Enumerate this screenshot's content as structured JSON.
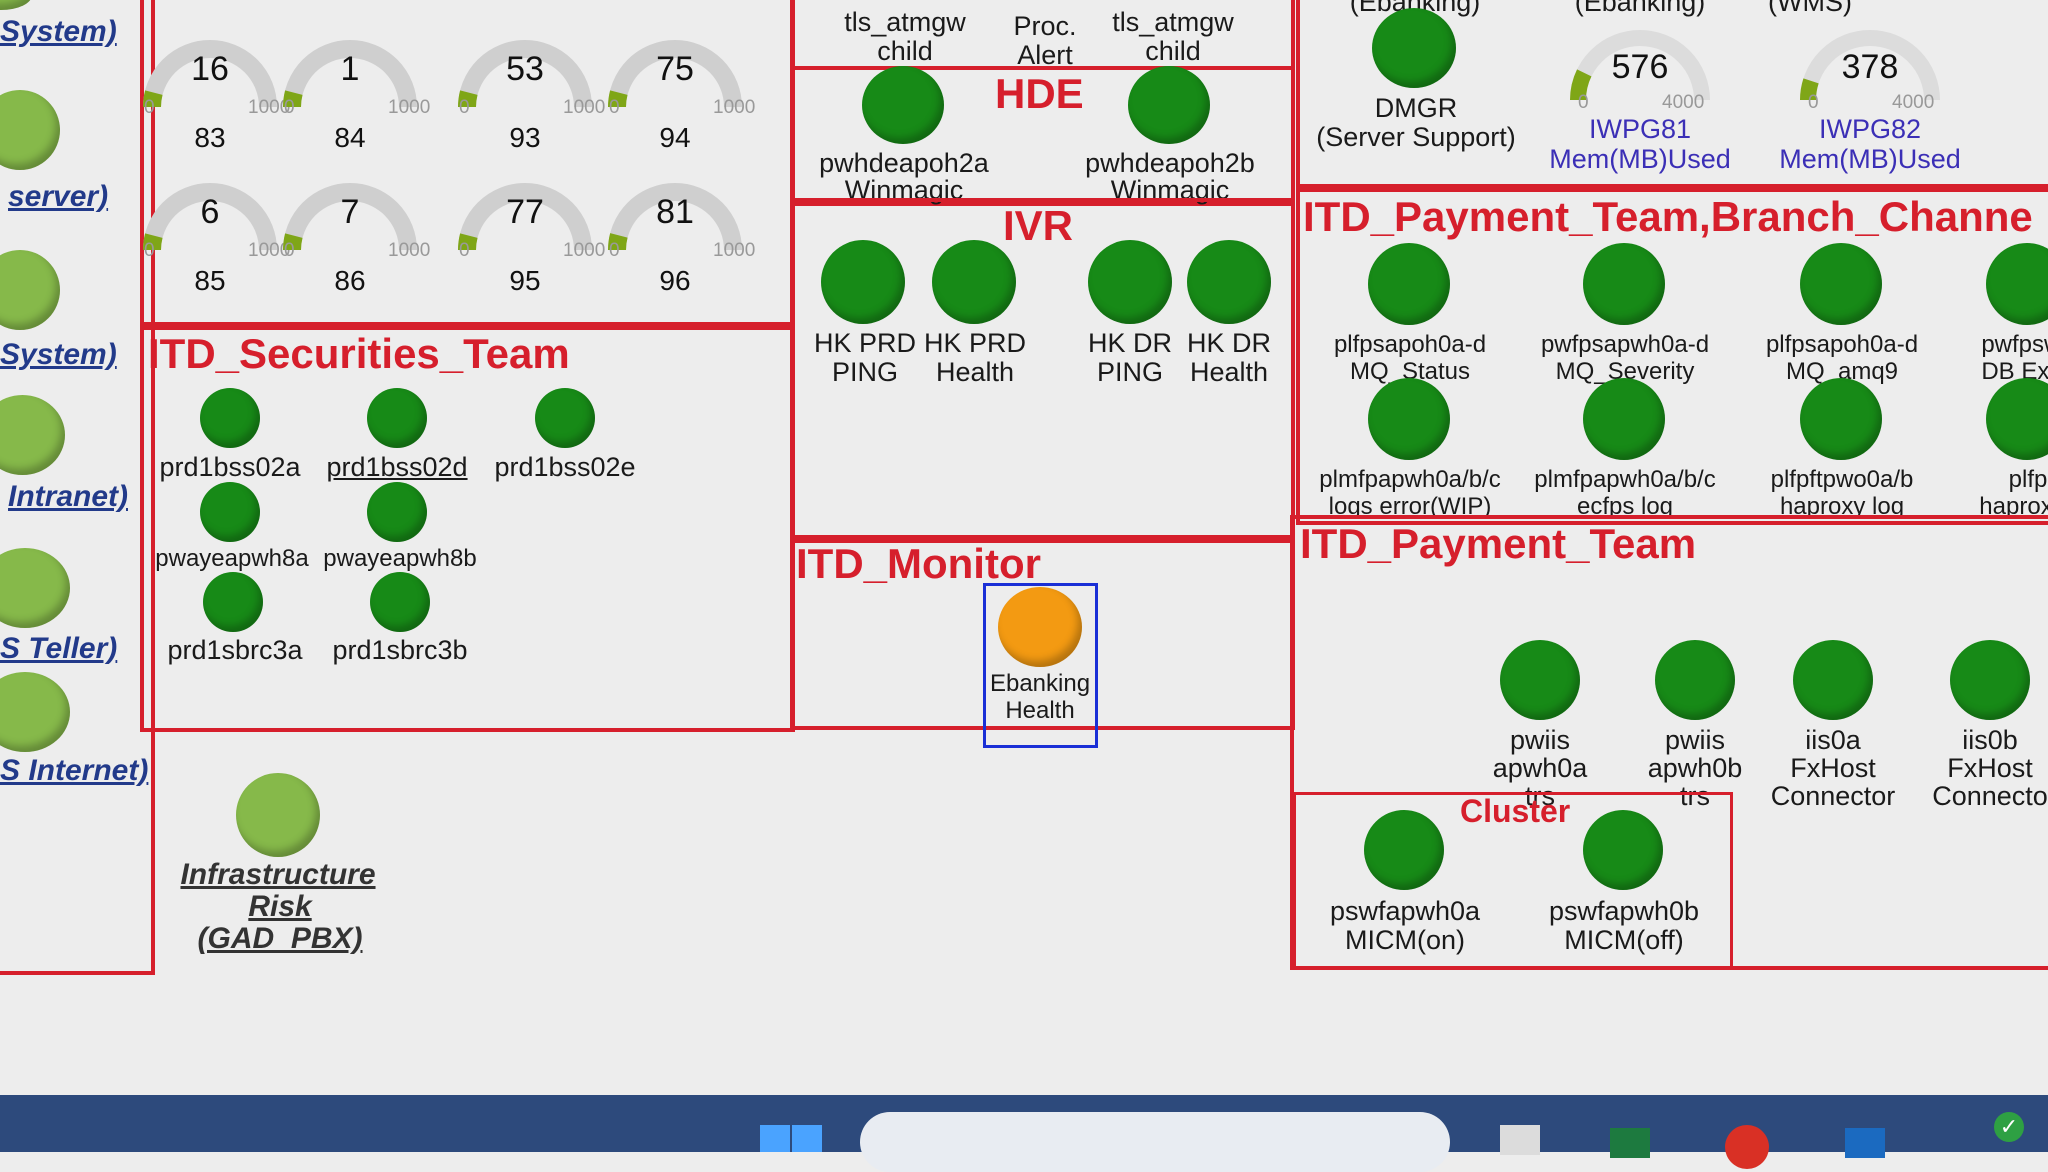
{
  "sidebar": {
    "labels": [
      "System)",
      "server)",
      "System)",
      "Intranet)",
      "S Teller)",
      "S Internet)"
    ]
  },
  "gauges": [
    {
      "value": "16",
      "id": "83",
      "min": "0",
      "max": "1000",
      "level": 0.016
    },
    {
      "value": "1",
      "id": "84",
      "min": "0",
      "max": "1000",
      "level": 0.001
    },
    {
      "value": "53",
      "id": "93",
      "min": "0",
      "max": "1000",
      "level": 0.053
    },
    {
      "value": "75",
      "id": "94",
      "min": "0",
      "max": "1000",
      "level": 0.075
    },
    {
      "value": "6",
      "id": "85",
      "min": "0",
      "max": "1000",
      "level": 0.006
    },
    {
      "value": "7",
      "id": "86",
      "min": "0",
      "max": "1000",
      "level": 0.007
    },
    {
      "value": "77",
      "id": "95",
      "min": "0",
      "max": "1000",
      "level": 0.077
    },
    {
      "value": "81",
      "id": "96",
      "min": "0",
      "max": "1000",
      "level": 0.081
    }
  ],
  "securities": {
    "title": "ITD_Securities_Team",
    "nodes": [
      "prd1bss02a",
      "prd1bss02d",
      "prd1bss02e",
      "pwayeapwh8a",
      "pwayeapwh8b",
      "prd1sbrc3a",
      "prd1sbrc3b"
    ]
  },
  "infra": {
    "line1": "Infrastructure",
    "line2": "Risk",
    "line3": "(GAD_PBX)"
  },
  "top_mid": {
    "col1": [
      "tls_atmgw",
      "child"
    ],
    "col2": [
      "Proc.",
      "Alert"
    ],
    "col3": [
      "tls_atmgw",
      "child"
    ]
  },
  "hde": {
    "title": "HDE",
    "nodes": [
      [
        "pwhdeapoh2a",
        "Winmagic"
      ],
      [
        "pwhdeapoh2b",
        "Winmagic"
      ]
    ]
  },
  "ivr": {
    "title": "IVR",
    "nodes": [
      [
        "HK PRD",
        "PING"
      ],
      [
        "HK PRD",
        "Health"
      ],
      [
        "HK DR",
        "PING"
      ],
      [
        "HK DR",
        "Health"
      ]
    ]
  },
  "monitor": {
    "title": "ITD_Monitor",
    "node": [
      "Ebanking",
      "Health"
    ]
  },
  "top_right": {
    "header1": "(Ebanking)",
    "header2": "(Ebanking)",
    "header3": "(WMS)",
    "dmgr": [
      "DMGR",
      "(Server Support)"
    ],
    "g1": {
      "value": "576",
      "min": "0",
      "max": "4000",
      "name": "IWPG81",
      "metric": "Mem(MB)Used",
      "level": 0.144
    },
    "g2": {
      "value": "378",
      "min": "0",
      "max": "4000",
      "name": "IWPG82",
      "metric": "Mem(MB)Used",
      "level": 0.0945
    }
  },
  "branch": {
    "title": "ITD_Payment_Team,Branch_Channe",
    "row1": [
      [
        "plfpsapoh0a-d",
        "MQ_Status"
      ],
      [
        "pwfpsapwh0a-d",
        "MQ_Severity"
      ],
      [
        "plfpsapoh0a-d",
        "MQ_amq9"
      ],
      [
        "pwfpswa",
        "DB Exce"
      ]
    ],
    "row2": [
      [
        "plmfpapwh0a/b/c",
        "logs error(WIP)"
      ],
      [
        "plmfpapwh0a/b/c",
        "ecfps log"
      ],
      [
        "plfpftpwo0a/b",
        "haproxy log"
      ],
      [
        "plfp",
        "haproxy/l"
      ]
    ]
  },
  "payment": {
    "title": "ITD_Payment_Team",
    "nodes": [
      [
        "pwiis",
        "apwh0a",
        "trs"
      ],
      [
        "pwiis",
        "apwh0b",
        "trs"
      ],
      [
        "iis0a",
        "FxHost",
        "Connector"
      ],
      [
        "iis0b",
        "FxHost",
        "Connecto"
      ]
    ],
    "cluster_title": "Cluster",
    "cluster_nodes": [
      [
        "pswfapwh0a",
        "MICM(on)"
      ],
      [
        "pswfapwh0b",
        "MICM(off)"
      ]
    ]
  },
  "colors": {
    "border": "#d61f2c",
    "ok": "#178a17",
    "ok_light": "#86b94a",
    "warn": "#f39a12",
    "select": "#1a2fd6"
  }
}
